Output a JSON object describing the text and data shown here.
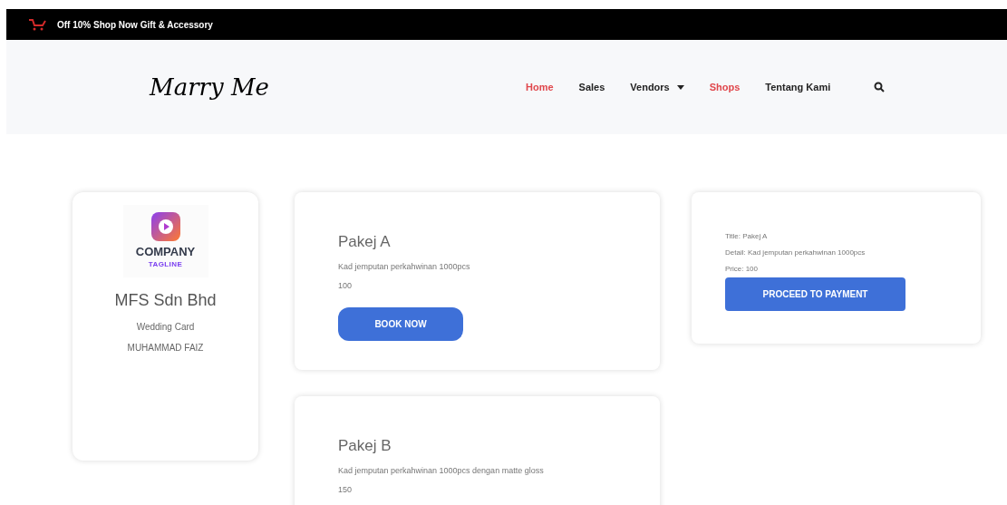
{
  "promo_bar": {
    "text": "Off 10% Shop Now Gift & Accessory"
  },
  "header": {
    "logo_text": "Marry Me",
    "nav": [
      {
        "label": "Home",
        "selected": true,
        "has_dropdown": false
      },
      {
        "label": "Sales",
        "selected": false,
        "has_dropdown": false
      },
      {
        "label": "Vendors",
        "selected": false,
        "has_dropdown": true
      },
      {
        "label": "Shops",
        "selected": true,
        "has_dropdown": false
      },
      {
        "label": "Tentang Kami",
        "selected": false,
        "has_dropdown": false
      }
    ]
  },
  "vendor": {
    "logo_name": "COMPANY",
    "logo_tagline": "TAGLINE",
    "name": "MFS Sdn Bhd",
    "category": "Wedding Card",
    "owner": "MUHAMMAD FAIZ"
  },
  "packages": [
    {
      "title": "Pakej A",
      "detail": "Kad jemputan perkahwinan 1000pcs",
      "price": "100",
      "button": "BOOK NOW"
    },
    {
      "title": "Pakej B",
      "detail": "Kad jemputan perkahwinan 1000pcs dengan matte gloss",
      "price": "150"
    }
  ],
  "summary": {
    "lines": [
      "Title: Pakej A",
      "Detail: Kad jemputan perkahwinan 1000pcs",
      "Price: 100"
    ],
    "button": "PROCEED TO PAYMENT"
  }
}
